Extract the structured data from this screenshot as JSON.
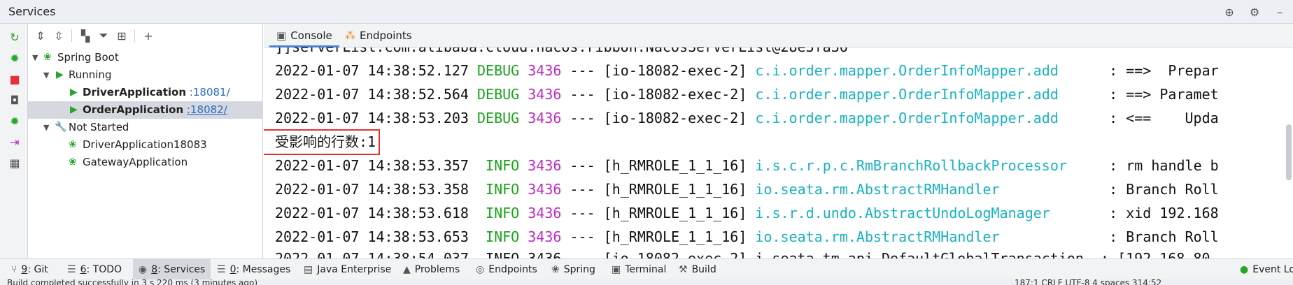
{
  "window": {
    "title": "Services"
  },
  "tree": {
    "root": "Spring Boot",
    "running_group": "Running",
    "running_items": [
      {
        "name": "DriverApplication",
        "port": ":18081/"
      },
      {
        "name": "OrderApplication",
        "port": ":18082/"
      }
    ],
    "not_started_group": "Not Started",
    "not_started_items": [
      "DriverApplication18083",
      "GatewayApplication"
    ]
  },
  "console": {
    "tabs": [
      {
        "label": "Console"
      },
      {
        "label": "Endpoints"
      }
    ],
    "top_partial": "]]serverList.com.alibaba.cloud.nacos.ribbon.NacosServerList@28e3fa36",
    "lines": [
      {
        "ts": "2022-01-07 14:38:52.127",
        "level": "DEBUG",
        "pid": "3436",
        "sep": "---",
        "thread": "[io-18082-exec-2]",
        "logger": "c.i.order.mapper.OrderInfoMapper.add",
        "msg": ": ==>  Prepar"
      },
      {
        "ts": "2022-01-07 14:38:52.564",
        "level": "DEBUG",
        "pid": "3436",
        "sep": "---",
        "thread": "[io-18082-exec-2]",
        "logger": "c.i.order.mapper.OrderInfoMapper.add",
        "msg": ": ==> Paramet"
      },
      {
        "ts": "2022-01-07 14:38:53.203",
        "level": "DEBUG",
        "pid": "3436",
        "sep": "---",
        "thread": "[io-18082-exec-2]",
        "logger": "c.i.order.mapper.OrderInfoMapper.add",
        "msg": ": <==    Upda"
      },
      {
        "ts": "2022-01-07 14:38:53.357",
        "level": "INFO",
        "pid": "3436",
        "sep": "---",
        "thread": "[h_RMROLE_1_1_16]",
        "logger": "i.s.c.r.p.c.RmBranchRollbackProcessor",
        "msg": ": rm handle b"
      },
      {
        "ts": "2022-01-07 14:38:53.358",
        "level": "INFO",
        "pid": "3436",
        "sep": "---",
        "thread": "[h_RMROLE_1_1_16]",
        "logger": "io.seata.rm.AbstractRMHandler",
        "msg": ": Branch Roll"
      },
      {
        "ts": "2022-01-07 14:38:53.618",
        "level": "INFO",
        "pid": "3436",
        "sep": "---",
        "thread": "[h_RMROLE_1_1_16]",
        "logger": "i.s.r.d.undo.AbstractUndoLogManager",
        "msg": ": xid 192.168"
      },
      {
        "ts": "2022-01-07 14:38:53.653",
        "level": "INFO",
        "pid": "3436",
        "sep": "---",
        "thread": "[h_RMROLE_1_1_16]",
        "logger": "io.seata.rm.AbstractRMHandler",
        "msg": ": Branch Roll"
      }
    ],
    "highlight_text": "受影响的行数:1",
    "bottom_partial": "2022-01-07 14:38:54.037  INFO 3436 --- [io-18082-exec-2] i.seata.tm.api.DefaultGlobalTransaction  : [192.168.80"
  },
  "bottom_tools": [
    {
      "key": "9",
      "label": ": Git"
    },
    {
      "key": "6",
      "label": ": TODO"
    },
    {
      "key": "8",
      "label": ": Services"
    },
    {
      "key": "0",
      "label": ": Messages"
    },
    {
      "key": "",
      "label": "Java Enterprise"
    },
    {
      "key": "",
      "label": "Problems"
    },
    {
      "key": "",
      "label": "Endpoints"
    },
    {
      "key": "",
      "label": "Spring"
    },
    {
      "key": "",
      "label": "Terminal"
    },
    {
      "key": "",
      "label": "Build"
    }
  ],
  "event_log": "Event Lo",
  "status": {
    "left": "Build completed successfully in 3 s 220 ms (3 minutes ago)",
    "right": "187:1   CRLF   UTF-8   4 spaces   314:52"
  },
  "colors": {
    "debug": "#1aa51a",
    "info": "#1aa51a",
    "pid": "#c02ac6",
    "logger": "#17b2c1",
    "highlight": "#e23232",
    "accent": "#4a7fd4"
  }
}
